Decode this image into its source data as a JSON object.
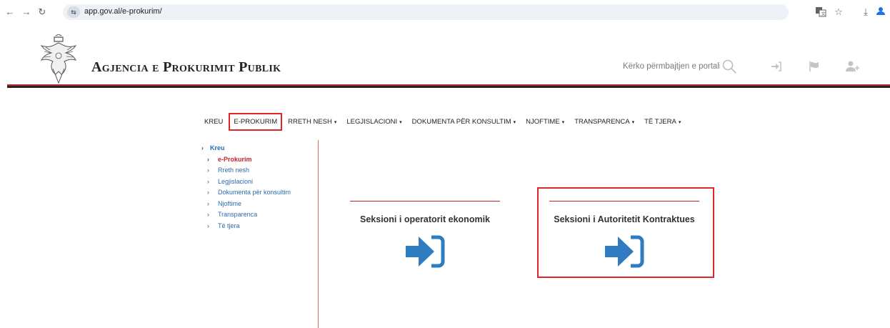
{
  "browser": {
    "url": "app.gov.al/e-prokurim/",
    "back_icon": "arrow-left-icon",
    "forward_icon": "arrow-right-icon",
    "reload_icon": "reload-icon"
  },
  "header": {
    "agency_title": "Agjencia e Prokurimit Publik",
    "search_placeholder": "Kërko përmbajtjen e portalit",
    "icons": [
      "search-icon",
      "login-icon",
      "flag-icon",
      "add-user-icon"
    ]
  },
  "menu": {
    "items": [
      {
        "label": "KREU",
        "dropdown": false
      },
      {
        "label": "E-PROKURIM",
        "dropdown": false
      },
      {
        "label": "RRETH NESH",
        "dropdown": true
      },
      {
        "label": "LEGJISLACIONI",
        "dropdown": true
      },
      {
        "label": "DOKUMENTA PËR KONSULTIM",
        "dropdown": true
      },
      {
        "label": "NJOFTIME",
        "dropdown": true
      },
      {
        "label": "TRANSPARENCA",
        "dropdown": true
      },
      {
        "label": "TË TJERA",
        "dropdown": true
      }
    ],
    "caret": "▾"
  },
  "sidebar": {
    "root": "Kreu",
    "items": [
      {
        "label": "e-Prokurim"
      },
      {
        "label": "Rreth nesh"
      },
      {
        "label": "Legjislacioni"
      },
      {
        "label": "Dokumenta për konsultim"
      },
      {
        "label": "Njoftime"
      },
      {
        "label": "Transparenca"
      },
      {
        "label": "Të tjera"
      }
    ]
  },
  "sections": {
    "operator": "Seksioni i operatorit ekonomik",
    "authority": "Seksioni i Autoritetit Kontraktues"
  },
  "colors": {
    "accent_red": "#c0272d",
    "highlight_red": "#e0252b",
    "link_blue": "#2a6bb2",
    "icon_blue": "#2f7cc1"
  }
}
